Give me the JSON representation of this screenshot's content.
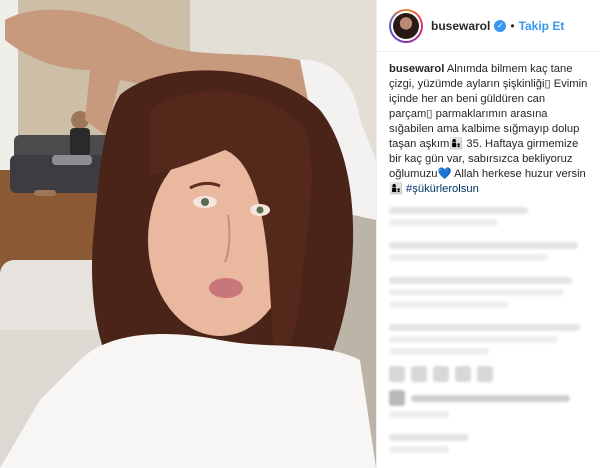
{
  "header": {
    "username": "busewarol",
    "separator": "•",
    "follow_label": "Takip Et"
  },
  "icons": {
    "verified": "verified-badge-icon",
    "avatar": "profile-avatar"
  },
  "caption": {
    "username": "busewarol",
    "part1": "Alnımda bilmem kaç tane çizgi, yüzümde ayların şişkinliği",
    "emoji_box1": "▯",
    "part2": " Evimin içinde her an beni güldüren can parçam",
    "emoji_box2": "▯",
    "part3": " parmaklarımın arasına sığabilen ama kalbime sığmayıp dolup taşan aşkım",
    "emoji_person1": "👩‍👦",
    "part4": " 35. Haftaya girmemize bir kaç gün var, sabırsızca bekliyoruz oğlumuzu",
    "heart": "💙",
    "part5": " Allah herkese huzur versin",
    "emoji_person2": "👩‍👦",
    "hashtag": "#şükürlerolsun"
  },
  "colors": {
    "link_blue": "#3897f0",
    "hashtag": "#003569",
    "border": "#efefef"
  }
}
